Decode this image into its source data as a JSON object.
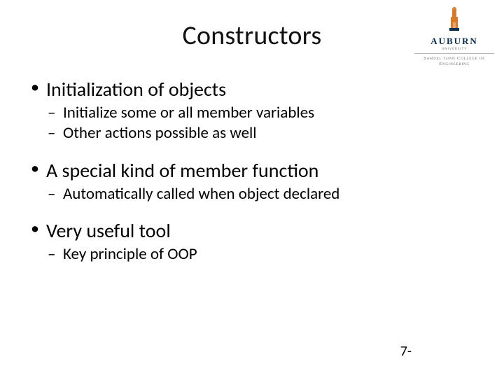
{
  "title": "Constructors",
  "logo": {
    "university": "AUBURN",
    "sub1": "UNIVERSITY",
    "sub2": "Samuel Ginn College of Engineering",
    "tower_color": "#d97a2b",
    "tower_accent": "#0a2d52"
  },
  "bullets": [
    {
      "text": "Initialization of objects",
      "sub": [
        "Initialize some or all member variables",
        "Other actions possible as well"
      ]
    },
    {
      "text": "A special kind of member function",
      "sub": [
        "Automatically called when object declared"
      ]
    },
    {
      "text": "Very useful tool",
      "sub": [
        "Key principle of OOP"
      ]
    }
  ],
  "page_number": "7-"
}
